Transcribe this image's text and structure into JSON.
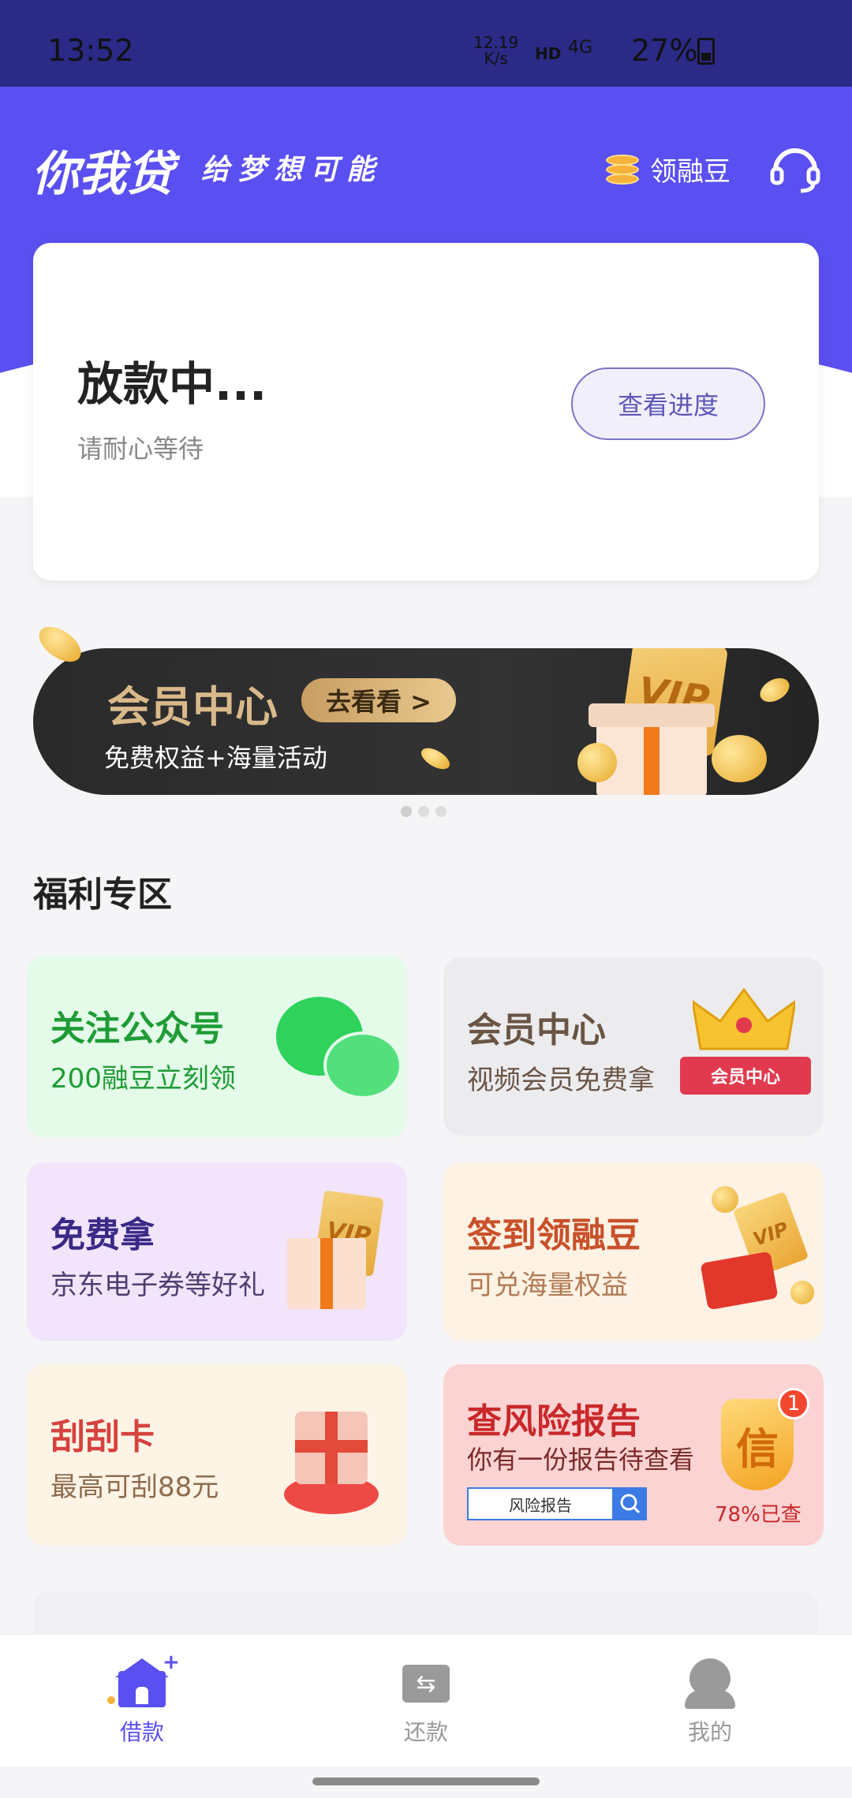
{
  "status_bar": {
    "time": "13:52",
    "net_speed_value": "12.19",
    "net_speed_unit": "K/s",
    "hd": "HD",
    "network": "4G",
    "battery": "27%"
  },
  "header": {
    "logo": "你我贷",
    "slogan": "给梦想可能",
    "coin_label": "领融豆",
    "coin_icon": "coin-stack-icon",
    "service_icon": "headset-icon",
    "brand_color": "#5a4ff0"
  },
  "status_card": {
    "title": "放款中...",
    "subtitle": "请耐心等待",
    "button": "查看进度"
  },
  "banner": {
    "title": "会员中心",
    "go_button": "去看看 >",
    "subtitle": "免费权益+海量活动",
    "vip_text": "VIP",
    "slides_total": 3,
    "active_slide": 1
  },
  "welfare": {
    "title": "福利专区",
    "tiles": [
      {
        "title": "关注公众号",
        "subtitle": "200融豆立刻领",
        "icon": "wechat-icon"
      },
      {
        "title": "会员中心",
        "subtitle": "视频会员免费拿",
        "icon": "crown-icon",
        "ribbon": "会员中心"
      },
      {
        "title": "免费拿",
        "subtitle": "京东电子券等好礼",
        "icon": "vip-gift-icon",
        "vip_text": "VIP"
      },
      {
        "title": "签到领融豆",
        "subtitle": "可兑海量权益",
        "icon": "red-packet-icon",
        "vip_text": "VIP"
      },
      {
        "title": "刮刮卡",
        "subtitle": "最高可刮88元",
        "icon": "gift-box-icon"
      },
      {
        "title": "查风险报告",
        "subtitle": "你有一份报告待查看",
        "icon": "shield-icon",
        "search_text": "风险报告",
        "shield_text": "信",
        "badge": "1",
        "percent": "78%已查"
      }
    ]
  },
  "tabbar": {
    "tabs": [
      {
        "label": "借款",
        "icon": "home-loan-icon",
        "active": true
      },
      {
        "label": "还款",
        "icon": "repay-icon",
        "active": false
      },
      {
        "label": "我的",
        "icon": "profile-icon",
        "active": false
      }
    ]
  }
}
